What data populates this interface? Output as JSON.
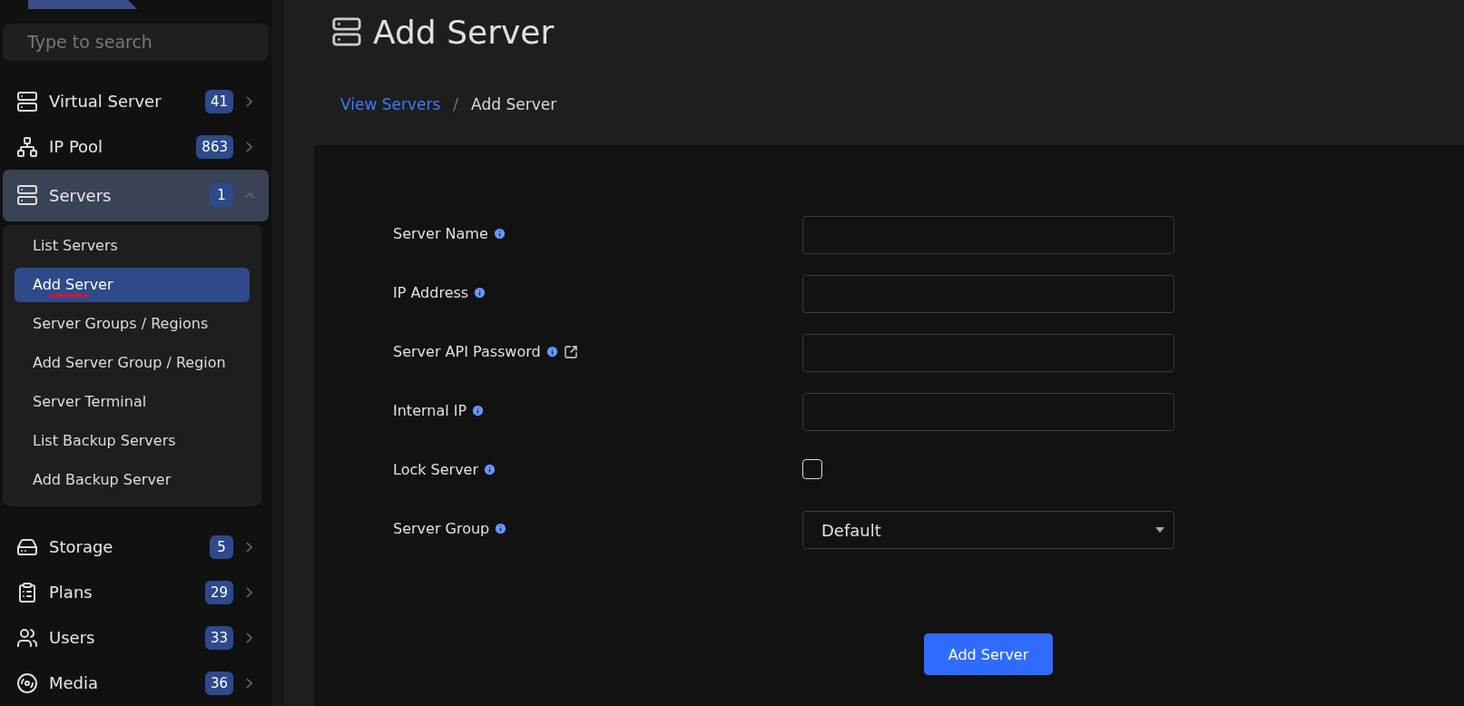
{
  "sidebar": {
    "search": {
      "placeholder": "Type to search"
    },
    "items": [
      {
        "label": "Virtual Server",
        "badge": "41",
        "expanded": false,
        "selected": false
      },
      {
        "label": "IP Pool",
        "badge": "863",
        "expanded": false,
        "selected": false
      },
      {
        "label": "Servers",
        "badge": "1",
        "expanded": true,
        "selected": true,
        "children": [
          {
            "label": "List Servers",
            "selected": false,
            "marked": false
          },
          {
            "label": "Add Server",
            "selected": true,
            "marked": true
          },
          {
            "label": "Server Groups / Regions",
            "selected": false,
            "marked": false
          },
          {
            "label": "Add Server Group / Region",
            "selected": false,
            "marked": false
          },
          {
            "label": "Server Terminal",
            "selected": false,
            "marked": false
          },
          {
            "label": "List Backup Servers",
            "selected": false,
            "marked": false
          },
          {
            "label": "Add Backup Server",
            "selected": false,
            "marked": false
          }
        ]
      },
      {
        "label": "Storage",
        "badge": "5",
        "expanded": false,
        "selected": false
      },
      {
        "label": "Plans",
        "badge": "29",
        "expanded": false,
        "selected": false
      },
      {
        "label": "Users",
        "badge": "33",
        "expanded": false,
        "selected": false
      },
      {
        "label": "Media",
        "badge": "36",
        "expanded": false,
        "selected": false
      }
    ]
  },
  "page": {
    "title": "Add Server"
  },
  "breadcrumb": {
    "separator": "/",
    "items": [
      {
        "label": "View Servers",
        "kind": "link"
      },
      {
        "label": "Add Server",
        "kind": "current"
      }
    ]
  },
  "form": {
    "fields": [
      {
        "label": "Server Name",
        "kind": "text",
        "external_link": false
      },
      {
        "label": "IP Address",
        "kind": "text",
        "external_link": false
      },
      {
        "label": "Server API Password",
        "kind": "text",
        "external_link": true
      },
      {
        "label": "Internal IP",
        "kind": "text",
        "external_link": false
      },
      {
        "label": "Lock Server",
        "kind": "checkbox",
        "checked": false,
        "external_link": false
      },
      {
        "label": "Server Group",
        "kind": "select",
        "value": "Default",
        "external_link": false
      }
    ],
    "submit": "Add Server"
  }
}
